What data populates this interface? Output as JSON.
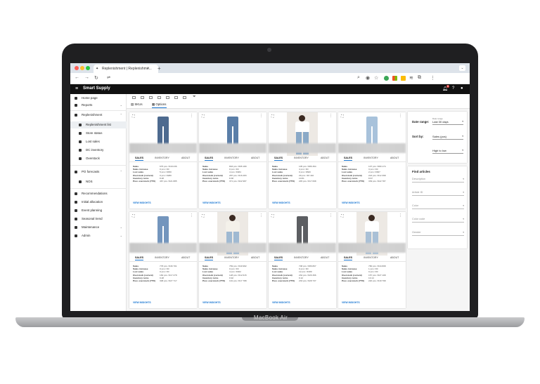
{
  "device_label": "MacBook Air",
  "browser": {
    "tab_title": "Replenishment | Replenishme...",
    "tab_close": "×",
    "new_tab": "+"
  },
  "app": {
    "title": "Smart Supply",
    "notification_count": "8"
  },
  "sidebar": {
    "items": [
      {
        "label": "Home page"
      },
      {
        "label": "Reports",
        "chev": "⌄"
      },
      {
        "label": "Replenishment",
        "chev": "⌃"
      },
      {
        "label": "Replenishment list"
      },
      {
        "label": "Store status"
      },
      {
        "label": "Lost sales"
      },
      {
        "label": "DC inventory"
      },
      {
        "label": "Overstock"
      },
      {
        "label": "PO forecasts",
        "chev": "⌃"
      },
      {
        "label": "NOS"
      },
      {
        "label": "Recommendations"
      },
      {
        "label": "Initial allocation"
      },
      {
        "label": "Event planning"
      },
      {
        "label": "Seasonal trend"
      },
      {
        "label": "Maintenance",
        "chev": "⌄"
      },
      {
        "label": "Admin",
        "chev": "⌄"
      }
    ]
  },
  "view_tabs": [
    "SKUs",
    "Options"
  ],
  "card_tabs": [
    "SALES",
    "INVENTORY",
    "ABOUT"
  ],
  "stat_labels": [
    "Sales",
    "Sales increase",
    "Lost sales",
    "Overstock (current)",
    "Inventory turns",
    "Prev. overstock (YTD)"
  ],
  "view_link": "VIEW INSIGHTS",
  "cards": [
    {
      "stats": [
        "675 pcs / €18 236",
        "0 pcs / €0",
        "5 pcs / €450",
        "0 pcs / €280",
        "8.28",
        "467 pcs / €21 885"
      ]
    },
    {
      "stats": [
        "803 pcs / €95 189",
        "0 pcs / €0",
        "4 pcs / €484",
        "287 pcs / €16 283",
        "8.38",
        "371 pcs / €22 987"
      ]
    },
    {
      "stats": [
        "105 pcs / €86 394",
        "4 pcs / €0",
        "0 pcs / €820",
        "29 pcs / €3 410",
        "10.81",
        "245 pcs / €17 098"
      ]
    },
    {
      "stats": [
        "107 pcs / €80 174",
        "3 pcs / €0",
        "2 pcs / €307",
        "224 pcs / €12 398",
        "8.67",
        "339 pcs / €22 787"
      ]
    },
    {
      "stats": [
        "778 pcs / €46 701",
        "0 pcs / €0",
        "0 pcs / €0",
        "182 pcs / €17 278",
        "9.28",
        "308 pcs / €27 717"
      ]
    },
    {
      "stats": [
        "769 pcs / €40 982",
        "0 pcs / €0",
        "4 pcs / €402",
        "128 pcs / €12 615",
        "9.92",
        "191 pcs / €17 788"
      ]
    },
    {
      "stats": [
        "708 pcs / €86 867",
        "0 pcs / €0",
        "12 pcs / €180",
        "232 pcs / €26 396",
        "9.12",
        "233 pcs / €28 737"
      ]
    },
    {
      "stats": [
        "780 pcs / €44 808",
        "1 pcs / €0",
        "0 pcs / €0",
        "157 pcs / €27 108",
        "10.14",
        "220 pcs / €18 798"
      ]
    }
  ],
  "controls": {
    "date_range_label": "Date range:",
    "date_range_small": "Date range",
    "date_range_value": "Last 30 days",
    "sort_by_label": "Sort by:",
    "sort_field": "Sales (pcs)",
    "sort_order": "High to low"
  },
  "find": {
    "title": "Find articles",
    "fields": [
      "Description",
      "Article ID",
      "Color",
      "Color code",
      "Gender"
    ]
  }
}
